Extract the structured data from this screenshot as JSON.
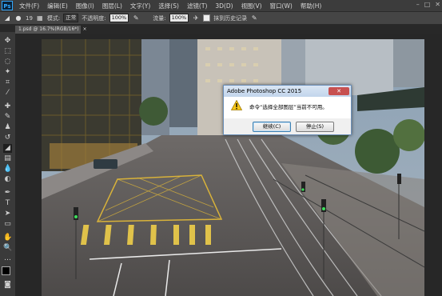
{
  "app": {
    "logo": "Ps"
  },
  "menu": [
    "文件(F)",
    "编辑(E)",
    "图像(I)",
    "图层(L)",
    "文字(Y)",
    "选择(S)",
    "滤镜(T)",
    "3D(D)",
    "视图(V)",
    "窗口(W)",
    "帮助(H)"
  ],
  "window_controls": {
    "minimize": "–",
    "maximize": "□",
    "close": "✕"
  },
  "options_bar": {
    "size_value": "19",
    "mode_label": "模式:",
    "mode_value": "正常",
    "opacity_label": "不透明度:",
    "opacity_value": "100%",
    "flow_label": "流量:",
    "flow_value": "100%",
    "history_label": "抹到历史记录"
  },
  "document_tab": {
    "title": "1.psd @ 16.7%(RGB/16*)",
    "close": "×"
  },
  "dialog": {
    "title": "Adobe Photoshop CC 2015",
    "close": "✕",
    "message": "命令“选择全部图层”当前不可用。",
    "continue_button": "继续(C)",
    "stop_button": "停止(S)"
  },
  "colors": {
    "accent": "#31a8ff",
    "warning": "#f5c518"
  }
}
